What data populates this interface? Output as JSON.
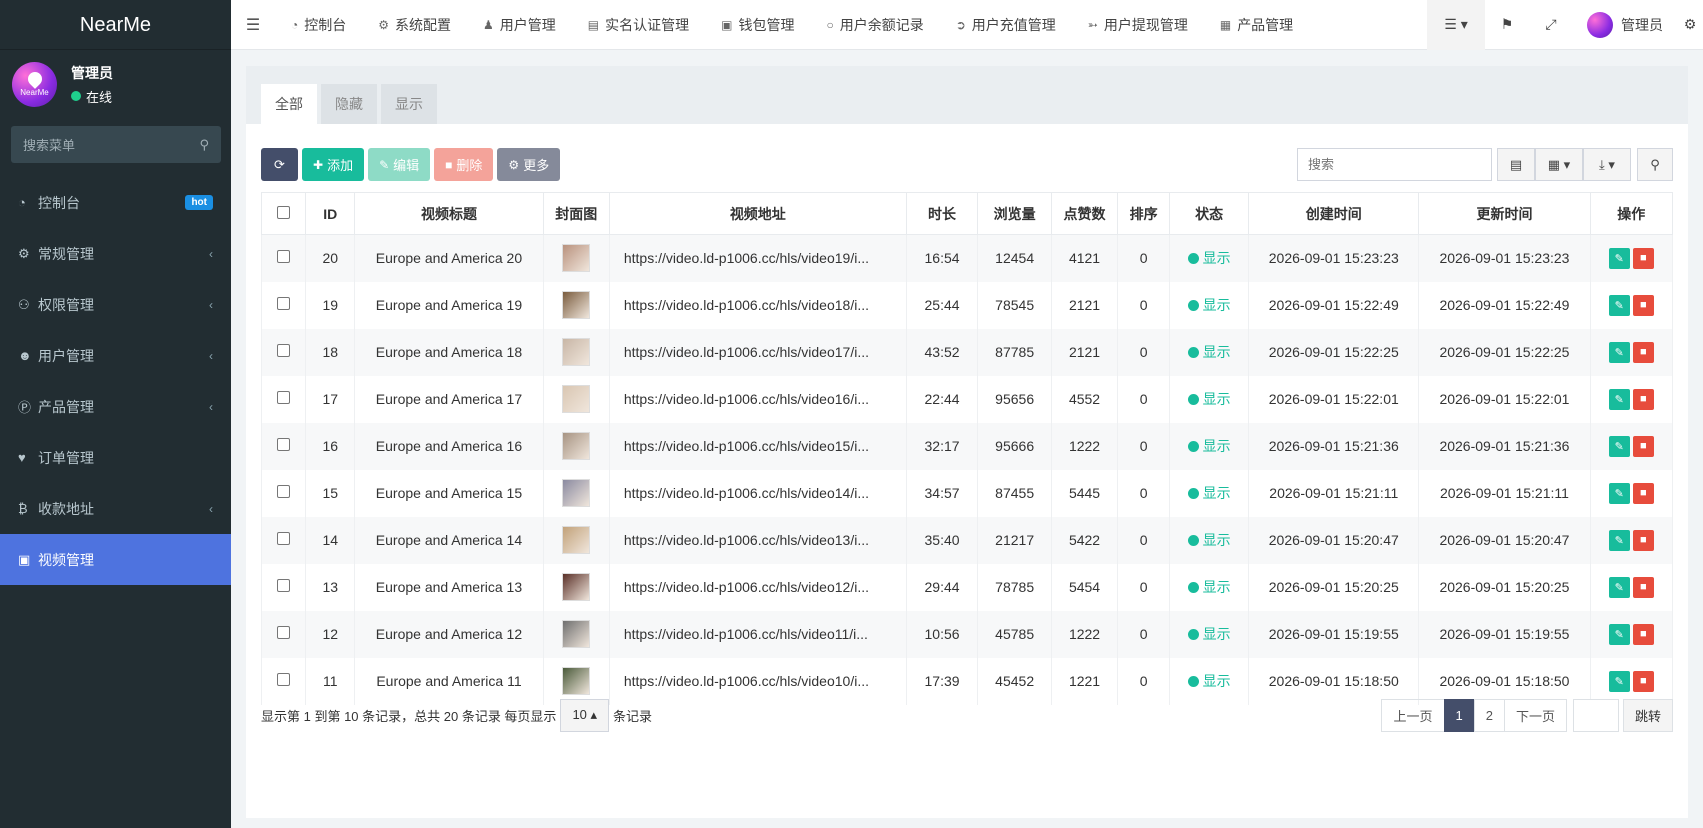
{
  "brand": "NearMe",
  "user": {
    "name": "管理员",
    "status": "在线",
    "avatar_text": "NearMe"
  },
  "sidebar_search": "搜索菜单",
  "menu": [
    {
      "label": "控制台",
      "icon": "dashboard-icon",
      "badge": "hot"
    },
    {
      "label": "常规管理",
      "icon": "cogs-icon",
      "chevron": "‹"
    },
    {
      "label": "权限管理",
      "icon": "users-icon",
      "chevron": "‹"
    },
    {
      "label": "用户管理",
      "icon": "user-circle-icon",
      "chevron": "‹"
    },
    {
      "label": "产品管理",
      "icon": "product-icon",
      "chevron": "‹"
    },
    {
      "label": "订单管理",
      "icon": "heartbeat-icon"
    },
    {
      "label": "收款地址",
      "icon": "bitcoin-icon",
      "chevron": "‹"
    },
    {
      "label": "视频管理",
      "icon": "video-camera-icon",
      "active": true
    }
  ],
  "topnav": [
    "控制台",
    "系统配置",
    "用户管理",
    "实名认证管理",
    "钱包管理",
    "用户余额记录",
    "用户充值管理",
    "用户提现管理",
    "产品管理"
  ],
  "admin_name": "管理员",
  "tabs": [
    "全部",
    "隐藏",
    "显示"
  ],
  "toolbar": {
    "add": "添加",
    "edit": "编辑",
    "delete": "删除",
    "more": "更多"
  },
  "search_placeholder": "搜索",
  "columns": [
    "ID",
    "视频标题",
    "封面图",
    "视频地址",
    "时长",
    "浏览量",
    "点赞数",
    "排序",
    "状态",
    "创建时间",
    "更新时间",
    "操作"
  ],
  "rows": [
    {
      "id": "20",
      "title": "Europe and America 20",
      "url": "https://video.ld-p1006.cc/hls/video19/i...",
      "duration": "16:54",
      "views": "12454",
      "likes": "4121",
      "sort": "0",
      "status": "显示",
      "created": "2026-09-01 15:23:23",
      "updated": "2026-09-01 15:23:23"
    },
    {
      "id": "19",
      "title": "Europe and America 19",
      "url": "https://video.ld-p1006.cc/hls/video18/i...",
      "duration": "25:44",
      "views": "78545",
      "likes": "2121",
      "sort": "0",
      "status": "显示",
      "created": "2026-09-01 15:22:49",
      "updated": "2026-09-01 15:22:49"
    },
    {
      "id": "18",
      "title": "Europe and America 18",
      "url": "https://video.ld-p1006.cc/hls/video17/i...",
      "duration": "43:52",
      "views": "87785",
      "likes": "2121",
      "sort": "0",
      "status": "显示",
      "created": "2026-09-01 15:22:25",
      "updated": "2026-09-01 15:22:25"
    },
    {
      "id": "17",
      "title": "Europe and America 17",
      "url": "https://video.ld-p1006.cc/hls/video16/i...",
      "duration": "22:44",
      "views": "95656",
      "likes": "4552",
      "sort": "0",
      "status": "显示",
      "created": "2026-09-01 15:22:01",
      "updated": "2026-09-01 15:22:01"
    },
    {
      "id": "16",
      "title": "Europe and America 16",
      "url": "https://video.ld-p1006.cc/hls/video15/i...",
      "duration": "32:17",
      "views": "95666",
      "likes": "1222",
      "sort": "0",
      "status": "显示",
      "created": "2026-09-01 15:21:36",
      "updated": "2026-09-01 15:21:36"
    },
    {
      "id": "15",
      "title": "Europe and America 15",
      "url": "https://video.ld-p1006.cc/hls/video14/i...",
      "duration": "34:57",
      "views": "87455",
      "likes": "5445",
      "sort": "0",
      "status": "显示",
      "created": "2026-09-01 15:21:11",
      "updated": "2026-09-01 15:21:11"
    },
    {
      "id": "14",
      "title": "Europe and America 14",
      "url": "https://video.ld-p1006.cc/hls/video13/i...",
      "duration": "35:40",
      "views": "21217",
      "likes": "5422",
      "sort": "0",
      "status": "显示",
      "created": "2026-09-01 15:20:47",
      "updated": "2026-09-01 15:20:47"
    },
    {
      "id": "13",
      "title": "Europe and America 13",
      "url": "https://video.ld-p1006.cc/hls/video12/i...",
      "duration": "29:44",
      "views": "78785",
      "likes": "5454",
      "sort": "0",
      "status": "显示",
      "created": "2026-09-01 15:20:25",
      "updated": "2026-09-01 15:20:25"
    },
    {
      "id": "12",
      "title": "Europe and America 12",
      "url": "https://video.ld-p1006.cc/hls/video11/i...",
      "duration": "10:56",
      "views": "45785",
      "likes": "1222",
      "sort": "0",
      "status": "显示",
      "created": "2026-09-01 15:19:55",
      "updated": "2026-09-01 15:19:55"
    },
    {
      "id": "11",
      "title": "Europe and America 11",
      "url": "https://video.ld-p1006.cc/hls/video10/i...",
      "duration": "17:39",
      "views": "45452",
      "likes": "1221",
      "sort": "0",
      "status": "显示",
      "created": "2026-09-01 15:18:50",
      "updated": "2026-09-01 15:18:50"
    }
  ],
  "footer": {
    "summary": "显示第 1 到第 10 条记录，总共 20 条记录 每页显示",
    "page_size": "10 ▴",
    "suffix": "条记录"
  },
  "pager": {
    "prev": "上一页",
    "pages": [
      "1",
      "2"
    ],
    "next": "下一页",
    "jump": "跳转"
  },
  "colors": {
    "sidebar_bg": "#222d32",
    "active_menu": "#4e73df",
    "success": "#18bc9c",
    "danger": "#e74c3c"
  }
}
